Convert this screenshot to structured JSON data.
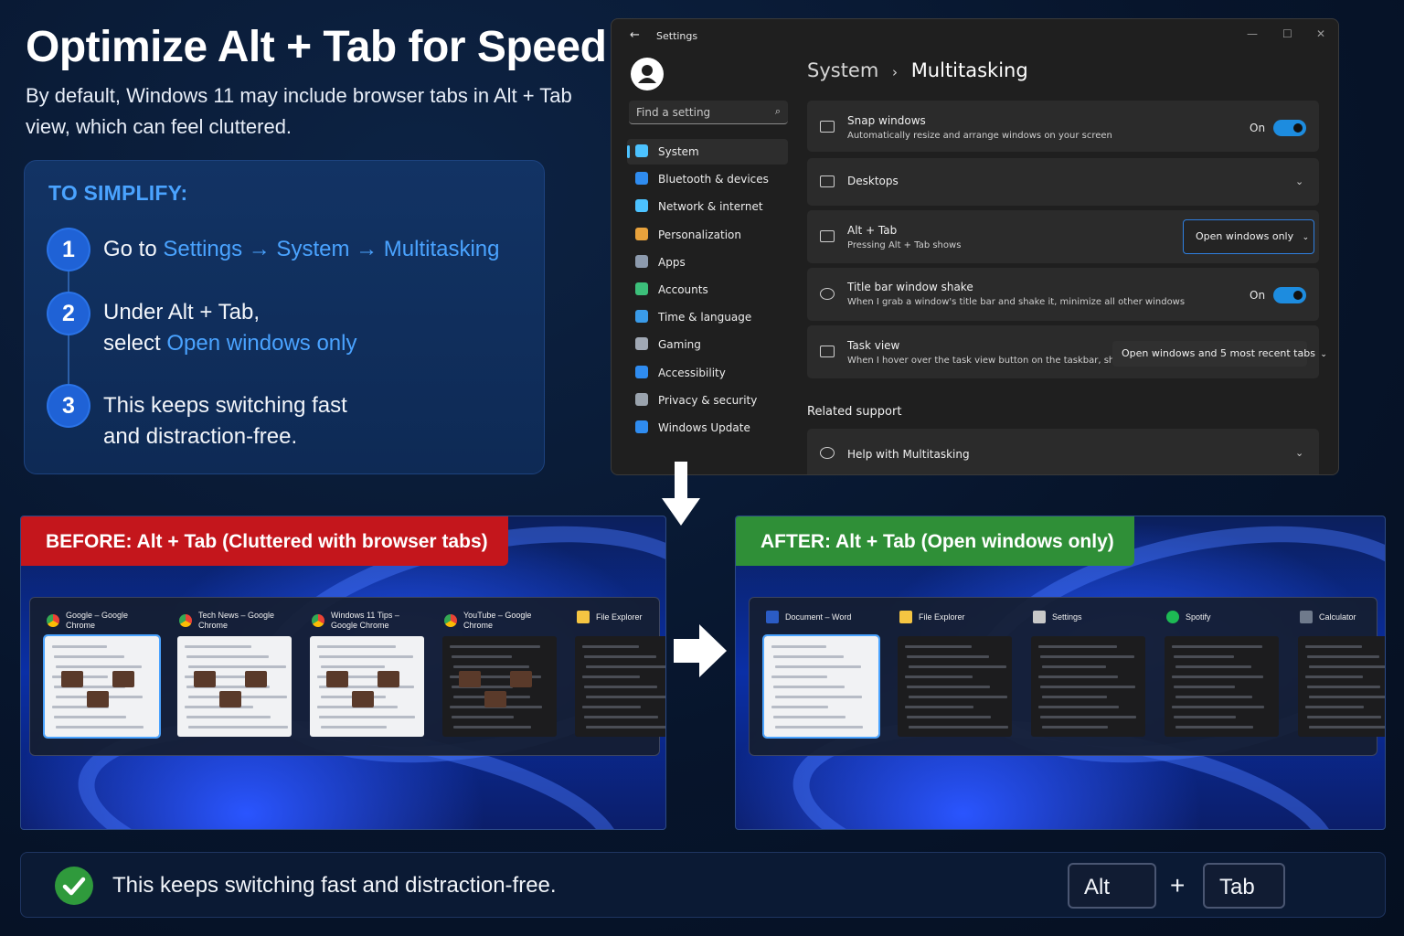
{
  "heading": {
    "title": "Optimize Alt + Tab for Speed",
    "subtitle": "By default, Windows 11 may include browser tabs in Alt + Tab view, which can feel cluttered."
  },
  "steps": {
    "heading": "TO SIMPLIFY:",
    "items": [
      {
        "number": "1",
        "prefix": "Go to ",
        "highlight": "Settings → System → Multitasking"
      },
      {
        "number": "2",
        "line1": "Under Alt + Tab,",
        "prefix": "select ",
        "highlight": "Open windows only"
      },
      {
        "number": "3",
        "line1": "This keeps switching fast",
        "line2": "and distraction-free."
      }
    ]
  },
  "settings": {
    "window_title": "Settings",
    "search_placeholder": "Find a setting",
    "nav": [
      {
        "label": "System",
        "active": true,
        "color": "#4cc2ff"
      },
      {
        "label": "Bluetooth & devices",
        "color": "#2f8cf0"
      },
      {
        "label": "Network & internet",
        "color": "#4cc2ff"
      },
      {
        "label": "Personalization",
        "color": "#e8a23c"
      },
      {
        "label": "Apps",
        "color": "#8c9aad"
      },
      {
        "label": "Accounts",
        "color": "#3cbf7a"
      },
      {
        "label": "Time & language",
        "color": "#3a9be8"
      },
      {
        "label": "Gaming",
        "color": "#a0a8b4"
      },
      {
        "label": "Accessibility",
        "color": "#2f8cf0"
      },
      {
        "label": "Privacy & security",
        "color": "#9aa3ad"
      },
      {
        "label": "Windows Update",
        "color": "#2f8cf0"
      }
    ],
    "breadcrumb_parent": "System",
    "breadcrumb_sep": "›",
    "breadcrumb_current": "Multitasking",
    "rows": {
      "snap": {
        "title": "Snap windows",
        "subtitle": "Automatically resize and arrange windows on your screen",
        "state": "On"
      },
      "desktops": {
        "title": "Desktops"
      },
      "alttab": {
        "title": "Alt + Tab",
        "subtitle": "Pressing Alt + Tab shows",
        "value": "Open windows only"
      },
      "shake": {
        "title": "Title bar window shake",
        "subtitle": "When I grab a window's title bar and shake it, minimize all other windows",
        "state": "On"
      },
      "taskview": {
        "title": "Task view",
        "subtitle": "When I hover over the task view button on the taskbar, show",
        "value": "Open windows and 5 most recent tabs"
      }
    },
    "related_heading": "Related support",
    "help_row": "Help with Multitasking"
  },
  "before": {
    "label": "BEFORE: Alt + Tab (Cluttered with browser tabs)",
    "windows": [
      {
        "title": "Google – Google Chrome",
        "icon": "chrome-icon",
        "theme": "light"
      },
      {
        "title": "Tech News – Google Chrome",
        "icon": "chrome-icon",
        "theme": "light"
      },
      {
        "title": "Windows 11 Tips – Google Chrome",
        "icon": "chrome-icon",
        "theme": "light"
      },
      {
        "title": "YouTube – Google Chrome",
        "icon": "chrome-icon",
        "theme": "dark"
      },
      {
        "title": "File Explorer",
        "icon": "folder-icon",
        "theme": "dark"
      }
    ]
  },
  "after": {
    "label": "AFTER: Alt + Tab (Open windows only)",
    "windows": [
      {
        "title": "Document – Word",
        "icon": "word-icon",
        "theme": "light"
      },
      {
        "title": "File Explorer",
        "icon": "folder-icon",
        "theme": "dark"
      },
      {
        "title": "Settings",
        "icon": "gear-icon",
        "theme": "dark"
      },
      {
        "title": "Spotify",
        "icon": "spotify-icon",
        "theme": "dark"
      },
      {
        "title": "Calculator",
        "icon": "calculator-icon",
        "theme": "dark"
      }
    ]
  },
  "footer": {
    "message": "This keeps switching fast and distraction-free.",
    "key1": "Alt",
    "plus": "+",
    "key2": "Tab"
  },
  "colors": {
    "accent": "#4aa3ff",
    "before": "#c4161c",
    "after": "#2f8f37",
    "check": "#2f9a3c"
  }
}
